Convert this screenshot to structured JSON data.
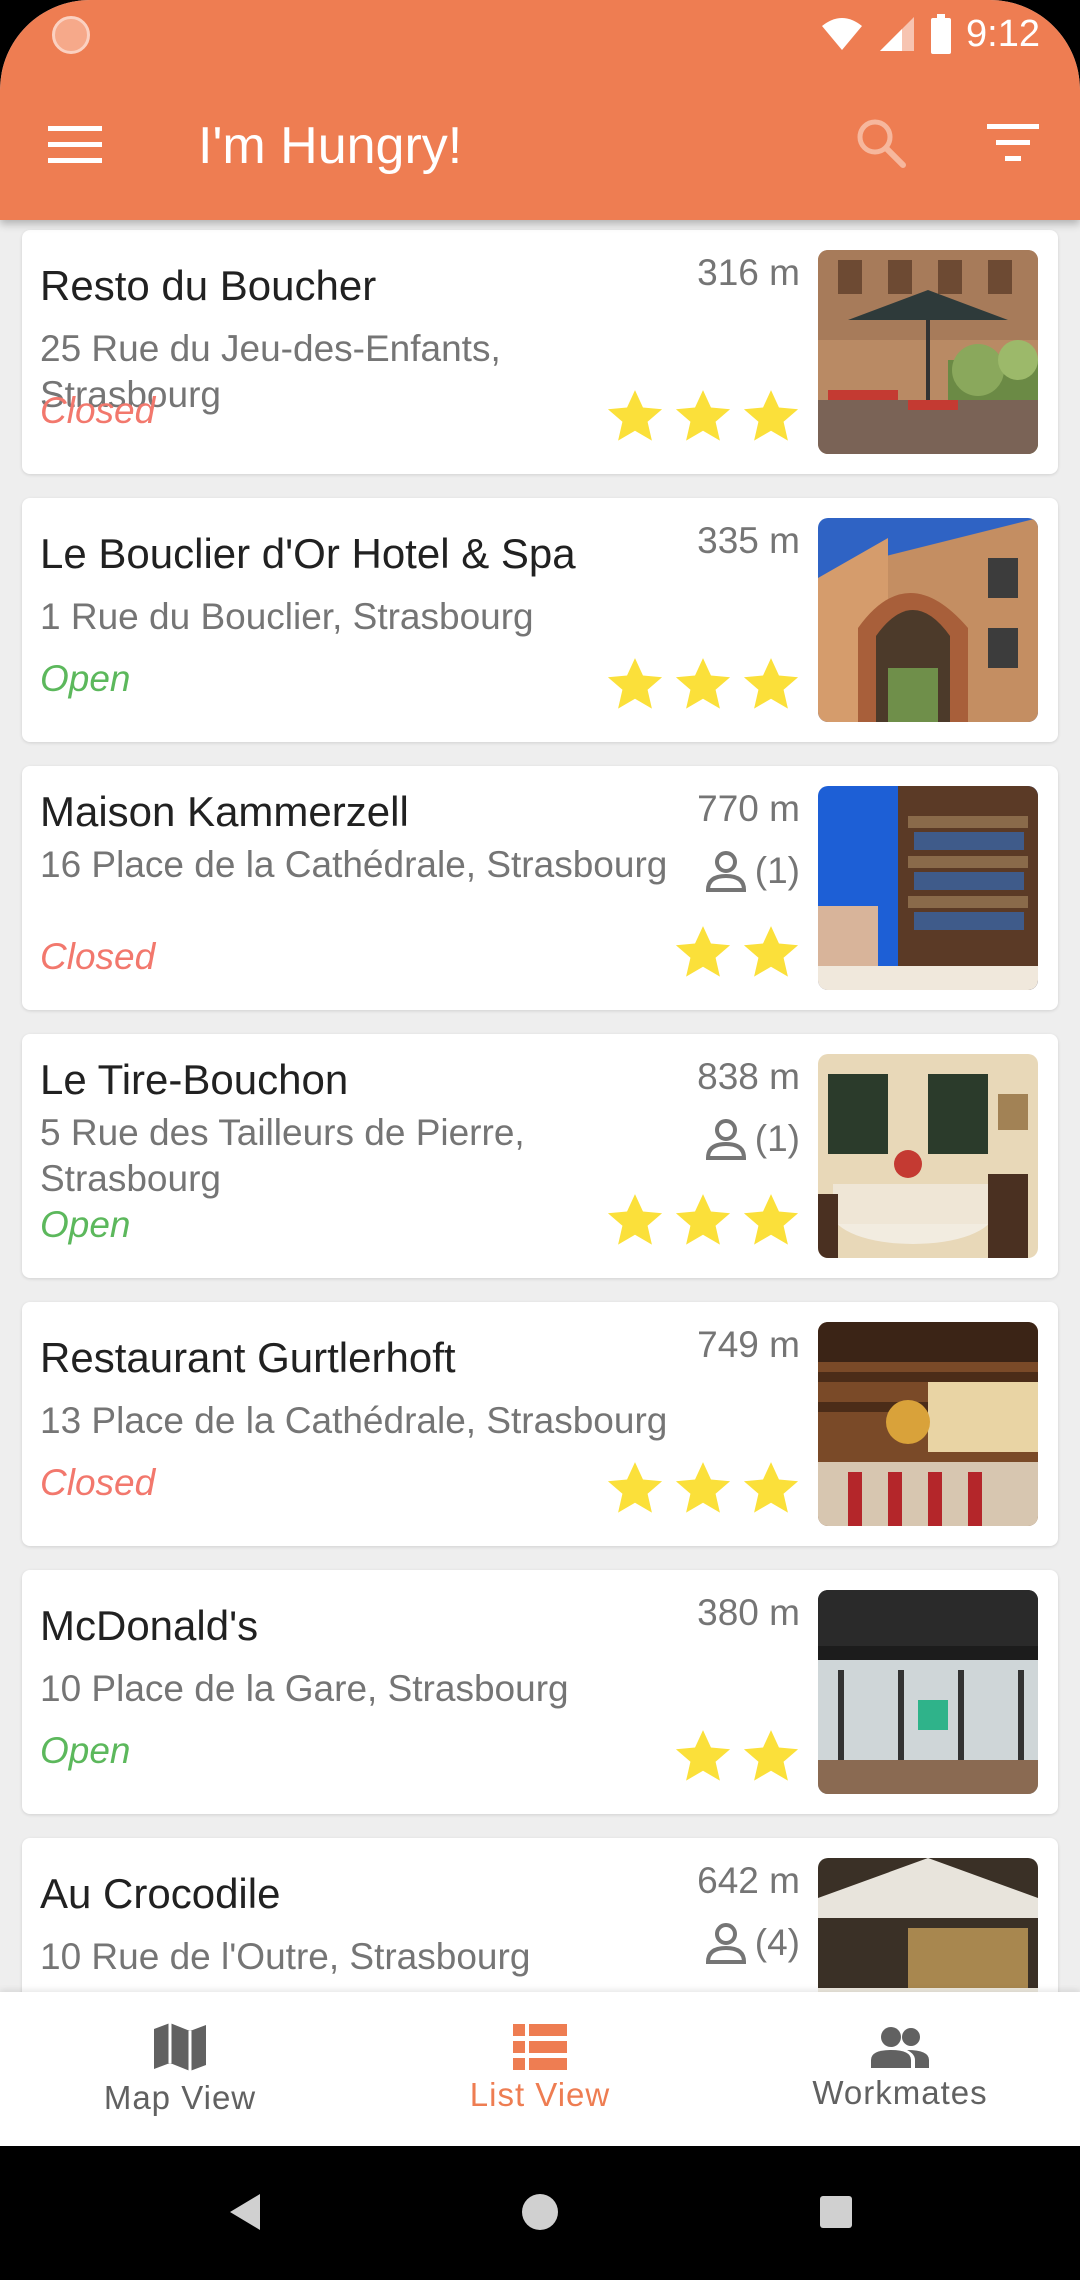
{
  "status_bar": {
    "time": "9:12"
  },
  "app_bar": {
    "title": "I'm Hungry!"
  },
  "colors": {
    "primary": "#ee7d52",
    "closed": "#f2786d",
    "open": "#5cb85c",
    "star": "#fbe03a"
  },
  "restaurants": [
    {
      "name": "Resto du Boucher",
      "address": "25 Rue du Jeu-des-Enfants, Strasbourg",
      "status": "Closed",
      "distance": "316 m",
      "workmates": "",
      "stars": 3
    },
    {
      "name": "Le Bouclier d'Or Hotel & Spa",
      "address": "1 Rue du Bouclier, Strasbourg",
      "status": "Open",
      "distance": "335 m",
      "workmates": "",
      "stars": 3
    },
    {
      "name": "Maison Kammerzell",
      "address": "16 Place de la Cathédrale, Strasbourg",
      "status": "Closed",
      "distance": "770 m",
      "workmates": "(1)",
      "stars": 2
    },
    {
      "name": "Le Tire-Bouchon",
      "address": "5 Rue des Tailleurs de Pierre, Strasbourg",
      "status": "Open",
      "distance": "838 m",
      "workmates": "(1)",
      "stars": 3
    },
    {
      "name": "Restaurant Gurtlerhoft",
      "address": "13 Place de la Cathédrale, Strasbourg",
      "status": "Closed",
      "distance": "749 m",
      "workmates": "",
      "stars": 3
    },
    {
      "name": "McDonald's",
      "address": "10 Place de la Gare, Strasbourg",
      "status": "Open",
      "distance": "380 m",
      "workmates": "",
      "stars": 2
    },
    {
      "name": "Au Crocodile",
      "address": "10 Rue de l'Outre, Strasbourg",
      "status": "",
      "distance": "642 m",
      "workmates": "(4)",
      "stars": 0
    }
  ],
  "bottom_nav": [
    {
      "label": "Map View",
      "icon": "map-icon",
      "active": false
    },
    {
      "label": "List View",
      "icon": "list-icon",
      "active": true
    },
    {
      "label": "Workmates",
      "icon": "people-icon",
      "active": false
    }
  ]
}
